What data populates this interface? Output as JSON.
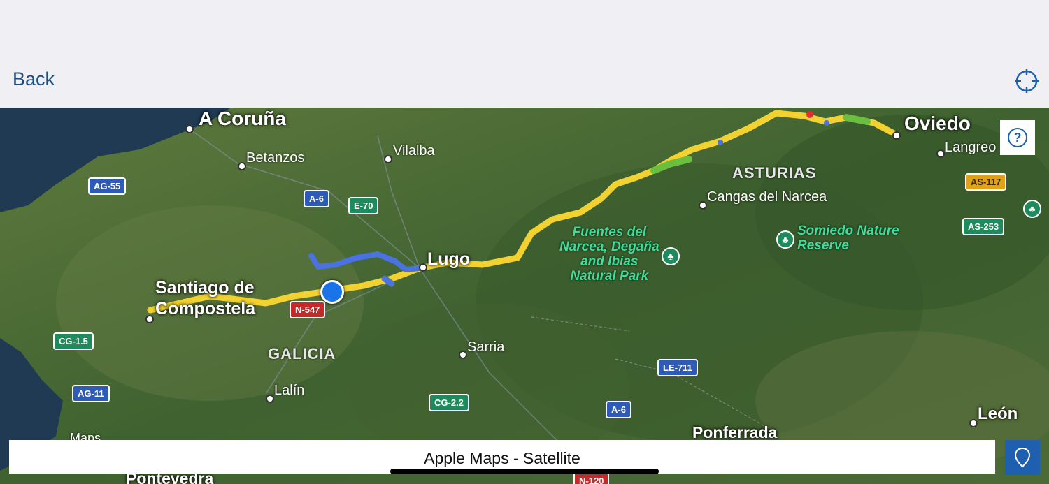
{
  "nav": {
    "back_label": "Back",
    "locate_icon": "crosshair-icon"
  },
  "map": {
    "provider_label": "Apple Maps - Satellite",
    "watermark": "Maps",
    "cities": {
      "a_coruna": "A Coruña",
      "santiago_1": "Santiago de",
      "santiago_2": "Compostela",
      "lugo": "Lugo",
      "oviedo": "Oviedo",
      "leon": "León",
      "ponferrada": "Ponferrada",
      "pontevedra": "Pontevedra"
    },
    "towns": {
      "betanzos": "Betanzos",
      "vilalba": "Vilalba",
      "sarria": "Sarria",
      "lalin": "Lalín",
      "cangas": "Cangas del Narcea",
      "langreo": "Langreo"
    },
    "regions": {
      "galicia": "GALICIA",
      "asturias": "ASTURIAS"
    },
    "parks": {
      "fuentes": [
        "Fuentes del",
        "Narcea, Degaña",
        "and Ibias",
        "Natural Park"
      ],
      "somiedo": [
        "Somiedo Nature",
        "Reserve"
      ]
    },
    "roads": {
      "ag55": "AG-55",
      "a6_top": "A-6",
      "e70": "E-70",
      "n547": "N-547",
      "cg15": "CG-1.5",
      "ag11": "AG-11",
      "cg22": "CG-2.2",
      "a6_bottom": "A-6",
      "le711": "LE-711",
      "n120": "N-120",
      "as117": "AS-117",
      "as253": "AS-253"
    },
    "colors": {
      "route": "#f2d230",
      "route_alt": "#4a72e0",
      "route_green": "#6abf3f",
      "current_location": "#1a73e8"
    }
  },
  "controls": {
    "help_icon": "question-icon",
    "pin_icon": "map-pin-icon"
  }
}
